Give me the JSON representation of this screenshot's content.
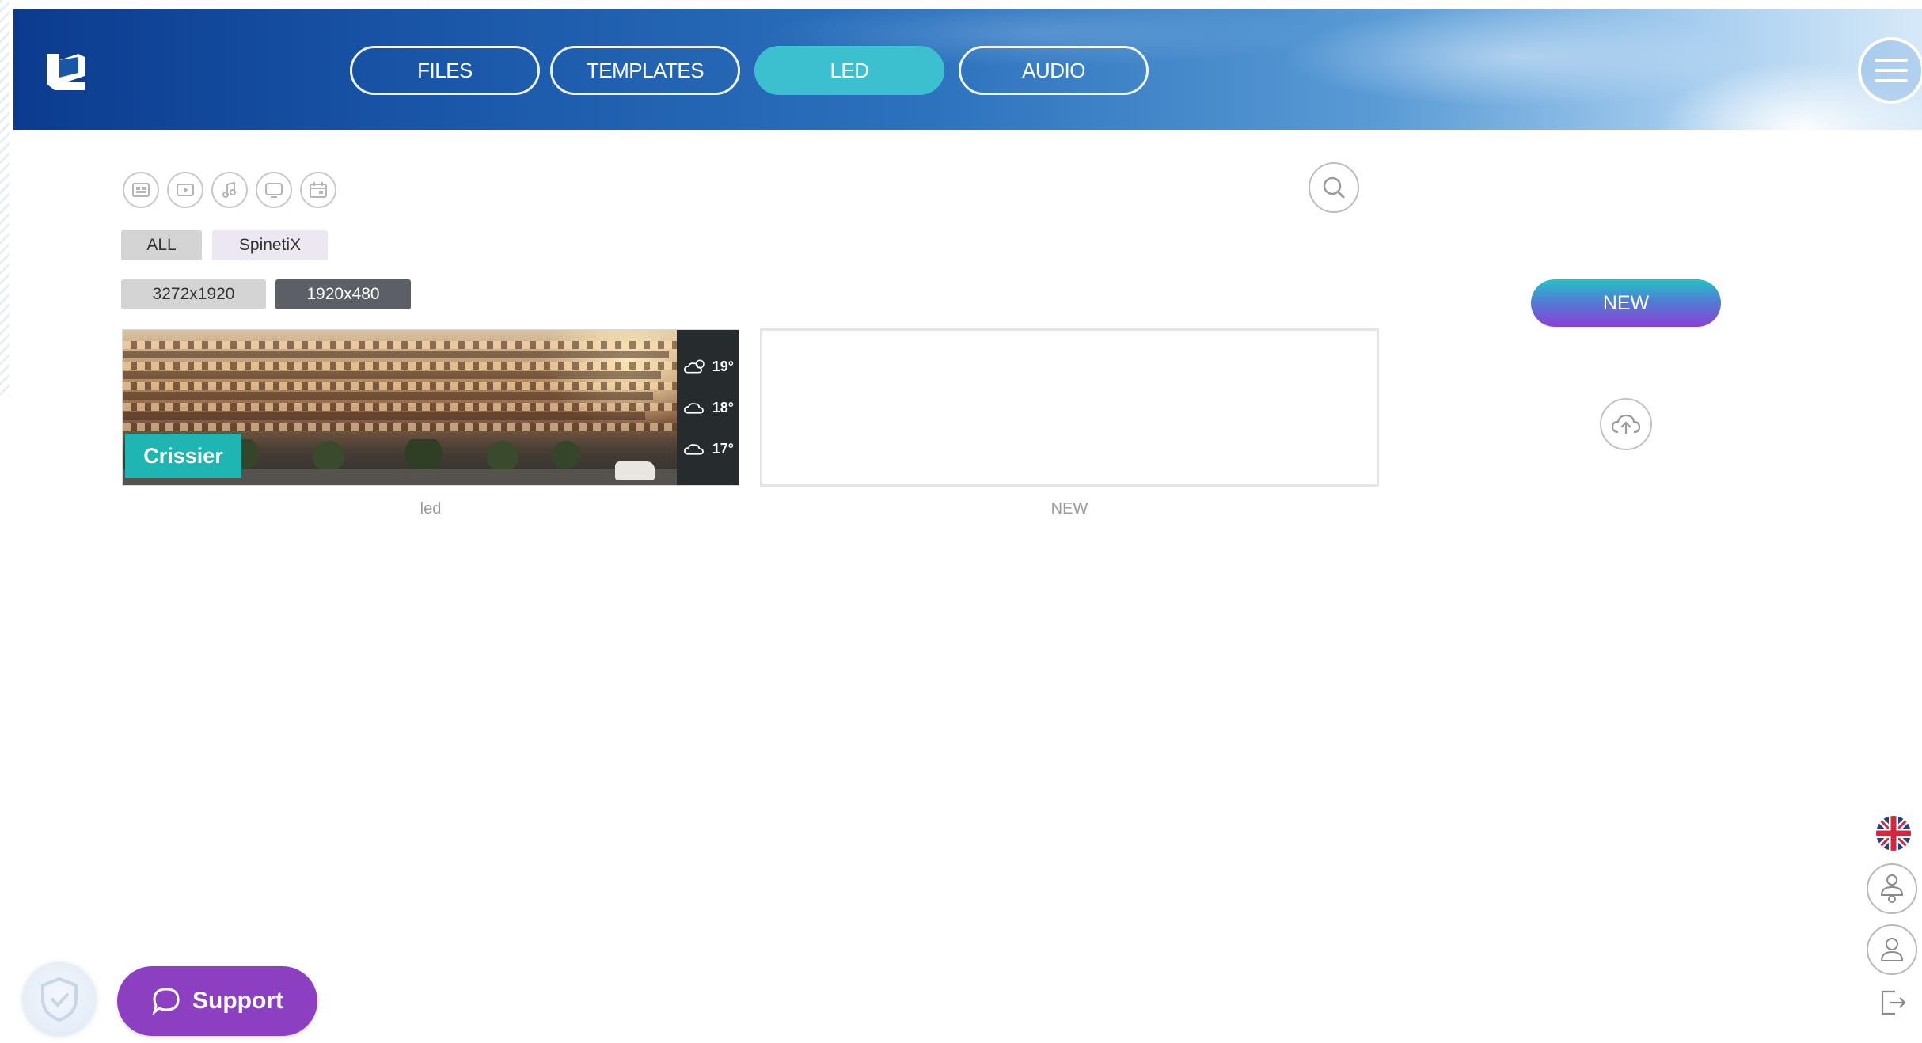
{
  "header": {
    "tabs": [
      {
        "label": "FILES"
      },
      {
        "label": "TEMPLATES"
      },
      {
        "label": "LED"
      },
      {
        "label": "AUDIO"
      }
    ],
    "active_tab": "LED",
    "logo_icon": "spinetix-logo-icon",
    "menu_icon": "hamburger-menu-icon"
  },
  "toolbar": {
    "filter_icons": [
      "image-filter-icon",
      "video-filter-icon",
      "music-filter-icon",
      "display-filter-icon",
      "calendar-filter-icon"
    ],
    "search_icon": "search-icon"
  },
  "filters": {
    "groups": [
      "ALL",
      "SpinetiX"
    ],
    "resolutions": [
      "3272x1920",
      "1920x480"
    ],
    "selected_resolution": "1920x480"
  },
  "cards": [
    {
      "caption": "led",
      "overlay_label": "Crissier",
      "weather": [
        {
          "icon": "cloud-sun-icon",
          "temp": "19°"
        },
        {
          "icon": "cloud-icon",
          "temp": "18°"
        },
        {
          "icon": "cloud-icon",
          "temp": "17°"
        }
      ]
    },
    {
      "caption": "NEW"
    }
  ],
  "actions": {
    "new_label": "NEW",
    "upload_icon": "cloud-upload-icon"
  },
  "side_controls": {
    "language_icon": "uk-flag-icon",
    "icons": [
      "user-settings-icon",
      "user-icon",
      "logout-icon"
    ]
  },
  "support": {
    "label": "Support",
    "icon": "chat-bubble-icon",
    "shield_icon": "shield-check-icon"
  },
  "colors": {
    "active_tab": "#3cc0cf",
    "overlay_label": "#1fb5b3",
    "support": "#8d3fc2",
    "selected_chip": "#5c6066"
  }
}
